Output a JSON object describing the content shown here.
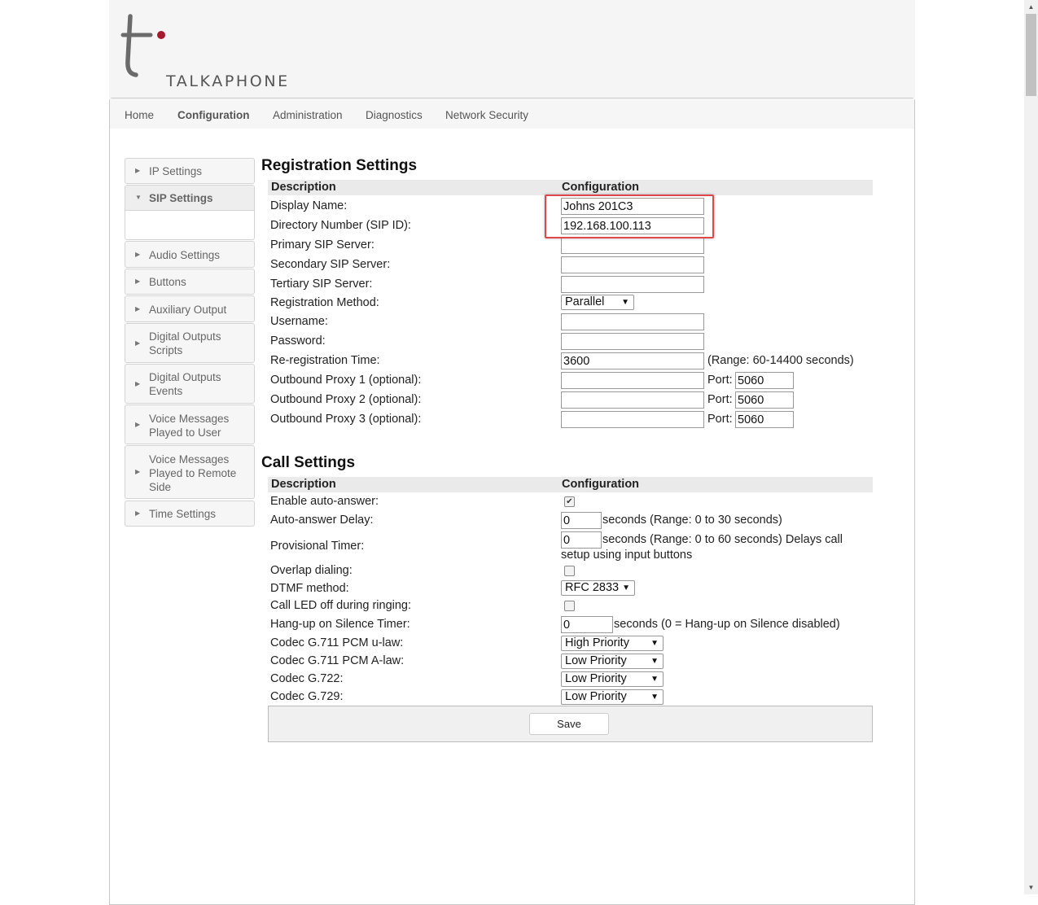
{
  "brand": {
    "name": "TALKAPHONE",
    "logo_letter": "t",
    "accent": "#a6192e"
  },
  "topnav": [
    "Home",
    "Configuration",
    "Administration",
    "Diagnostics",
    "Network Security"
  ],
  "sidebar": [
    {
      "label": "IP Settings"
    },
    {
      "label": "SIP Settings"
    },
    {
      "label": "Audio Settings"
    },
    {
      "label": "Buttons"
    },
    {
      "label": "Auxiliary Output"
    },
    {
      "label": "Digital Outputs Scripts"
    },
    {
      "label": "Digital Outputs Events"
    },
    {
      "label": "Voice Messages Played to User"
    },
    {
      "label": "Voice Messages Played to Remote Side"
    },
    {
      "label": "Time Settings"
    }
  ],
  "registration": {
    "title": "Registration Settings",
    "col_desc": "Description",
    "col_conf": "Configuration",
    "display_name_label": "Display Name:",
    "display_name_value": "Johns 201C3",
    "directory_number_label": "Directory Number (SIP ID):",
    "directory_number_value": "192.168.100.113",
    "primary_label": "Primary SIP Server:",
    "primary_value": "",
    "secondary_label": "Secondary SIP Server:",
    "secondary_value": "",
    "tertiary_label": "Tertiary SIP Server:",
    "tertiary_value": "",
    "method_label": "Registration Method:",
    "method_value": "Parallel",
    "username_label": "Username:",
    "username_value": "",
    "password_label": "Password:",
    "password_value": "",
    "rereg_label": "Re-registration Time:",
    "rereg_value": "3600",
    "rereg_range": "(Range: 60-14400 seconds)",
    "port_label": "Port:",
    "proxy1_label": "Outbound Proxy 1 (optional):",
    "proxy1_value": "",
    "proxy1_port": "5060",
    "proxy2_label": "Outbound Proxy 2 (optional):",
    "proxy2_value": "",
    "proxy2_port": "5060",
    "proxy3_label": "Outbound Proxy 3 (optional):",
    "proxy3_value": "",
    "proxy3_port": "5060"
  },
  "call": {
    "title": "Call Settings",
    "col_desc": "Description",
    "col_conf": "Configuration",
    "auto_answer_label": "Enable auto-answer:",
    "auto_answer_checked": true,
    "auto_delay_label": "Auto-answer Delay:",
    "auto_delay_value": "0",
    "auto_delay_hint": "seconds (Range: 0 to 30 seconds)",
    "prov_label": "Provisional Timer:",
    "prov_value": "0",
    "prov_hint1": "seconds (Range: 0 to 60 seconds) Delays call",
    "prov_hint2": "setup using input buttons",
    "overlap_label": "Overlap dialing:",
    "overlap_checked": false,
    "dtmf_label": "DTMF method:",
    "dtmf_value": "RFC 2833",
    "led_label": "Call LED off during ringing:",
    "led_checked": false,
    "hangup_label": "Hang-up on Silence Timer:",
    "hangup_value": "0",
    "hangup_hint": "seconds (0 = Hang-up on Silence disabled)",
    "ulaw_label": "Codec G.711 PCM u-law:",
    "ulaw_value": "High Priority",
    "alaw_label": "Codec G.711 PCM A-law:",
    "alaw_value": "Low Priority",
    "g722_label": "Codec G.722:",
    "g722_value": "Low Priority",
    "g729_label": "Codec G.729:",
    "g729_value": "Low Priority"
  },
  "save_label": "Save",
  "check_glyph": "✔",
  "dropdown_glyph": "▼",
  "collapsed_glyph": "▶",
  "expanded_glyph": "▼",
  "scroll_up_glyph": "▲",
  "scroll_down_glyph": "▼"
}
